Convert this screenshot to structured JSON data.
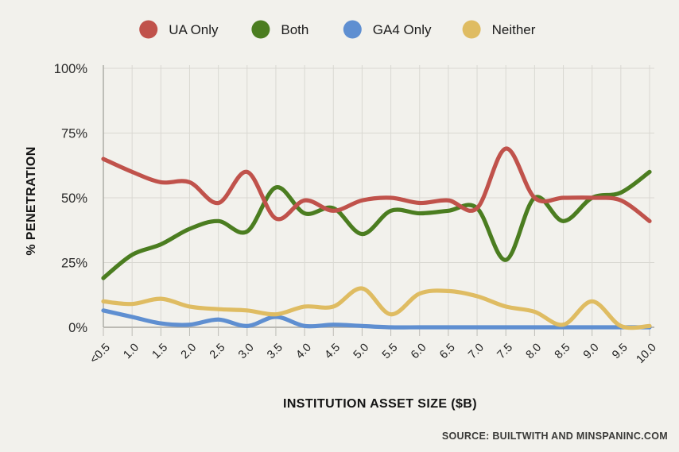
{
  "figure": {
    "background_color": "#f2f1ec",
    "source_note": "SOURCE: BUILTWITH AND MINSPANINC.COM"
  },
  "legend": {
    "position": "top-center",
    "items": [
      {
        "label": "UA Only",
        "color": "#c0524b"
      },
      {
        "label": "Both",
        "color": "#4b7d20"
      },
      {
        "label": "GA4 Only",
        "color": "#5f8fd1"
      },
      {
        "label": "Neither",
        "color": "#dfbc62"
      }
    ]
  },
  "axes": {
    "y_title": "% PENETRATION",
    "x_title": "INSTITUTION ASSET SIZE ($B)",
    "y_ticks": [
      "0%",
      "25%",
      "50%",
      "75%",
      "100%"
    ],
    "x_ticks": [
      "<0.5",
      "1.0",
      "1.5",
      "2.0",
      "2.5",
      "3.0",
      "3.5",
      "4.0",
      "4.5",
      "5.0",
      "5.5",
      "6.0",
      "6.5",
      "7.0",
      "7.5",
      "8.0",
      "8.5",
      "9.0",
      "9.5",
      "10.0"
    ]
  },
  "chart_data": {
    "type": "line",
    "title": "",
    "subtitle": "",
    "xlabel": "INSTITUTION ASSET SIZE ($B)",
    "ylabel": "% PENETRATION",
    "xlim": [
      0,
      19
    ],
    "ylim": [
      0,
      100
    ],
    "ytick_values": [
      0,
      25,
      50,
      75,
      100
    ],
    "grid": true,
    "grid_axis": "both",
    "legend_position": "top-center",
    "categories": [
      "<0.5",
      "1.0",
      "1.5",
      "2.0",
      "2.5",
      "3.0",
      "3.5",
      "4.0",
      "4.5",
      "5.0",
      "5.5",
      "6.0",
      "6.5",
      "7.0",
      "7.5",
      "8.0",
      "8.5",
      "9.0",
      "9.5",
      "10.0"
    ],
    "series": [
      {
        "name": "UA Only",
        "color": "#c0524b",
        "values": [
          65,
          60,
          56,
          56,
          48,
          60,
          42,
          49,
          45,
          49,
          50,
          48,
          49,
          46,
          69,
          50,
          50,
          50,
          49,
          41
        ]
      },
      {
        "name": "Both",
        "color": "#4b7d20",
        "values": [
          19,
          28,
          32,
          38,
          41,
          37,
          54,
          44,
          46,
          36,
          45,
          44,
          45,
          46,
          26,
          50,
          41,
          50,
          52,
          60
        ]
      },
      {
        "name": "GA4 Only",
        "color": "#5f8fd1",
        "values": [
          6.5,
          4,
          1.5,
          1,
          3,
          0.5,
          4,
          0.5,
          1,
          0.5,
          0,
          0,
          0,
          0,
          0,
          0,
          0,
          0,
          0,
          0
        ]
      },
      {
        "name": "Neither",
        "color": "#dfbc62",
        "values": [
          10,
          9,
          11,
          8,
          7,
          6.5,
          5,
          8,
          8,
          15,
          5,
          13,
          14,
          12,
          8,
          6,
          1,
          10,
          0.5,
          0.5
        ]
      }
    ]
  }
}
